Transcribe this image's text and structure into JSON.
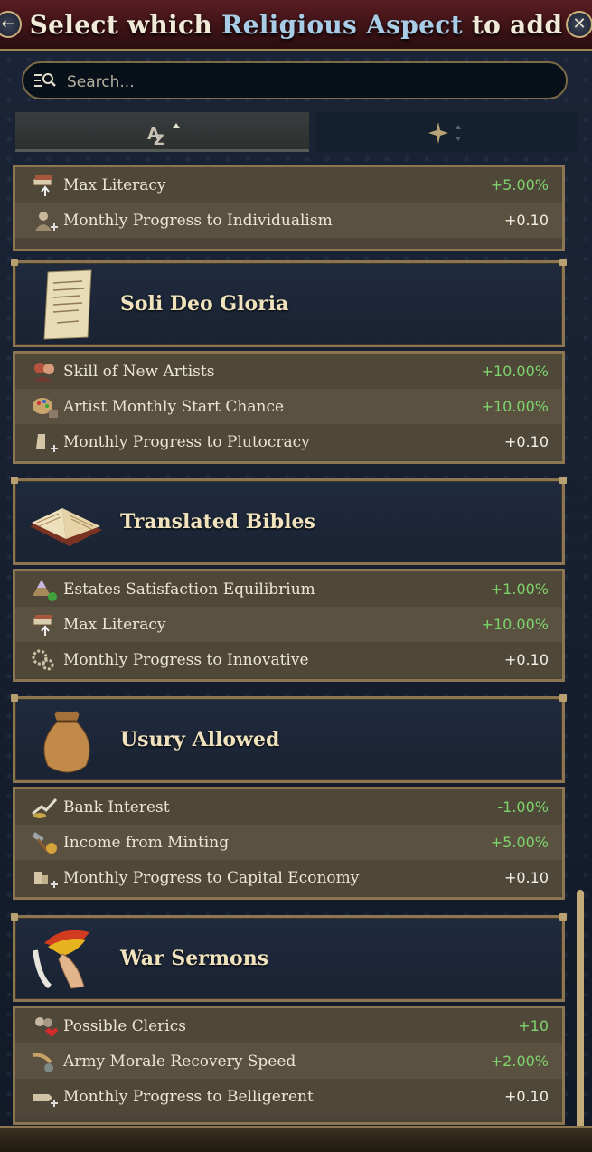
{
  "header": {
    "title_pre": "Select which ",
    "title_highlight": "Religious Aspect",
    "title_post": " to add",
    "back_icon": "back-arrow-icon",
    "close_icon": "close-x-icon"
  },
  "search": {
    "placeholder": "Search...",
    "value": ""
  },
  "sort_tabs": [
    {
      "icon": "alphabetical-sort-icon",
      "state": "ascending",
      "active": true
    },
    {
      "icon": "importance-sort-icon",
      "state": "unsorted",
      "active": false
    }
  ],
  "colors": {
    "positive": "#7ed46c",
    "neutral": "#f2efe6",
    "highlight": "#a9cde6",
    "gold_border": "#8b7651"
  },
  "partial_card": {
    "rows": [
      {
        "icon": "max-literacy-icon",
        "label": "Max Literacy",
        "value": "+5.00%",
        "tone": "pos"
      },
      {
        "icon": "individualism-icon",
        "label": "Monthly Progress to Individualism",
        "value": "+0.10",
        "tone": "neutral"
      }
    ]
  },
  "aspects": [
    {
      "name": "Soli Deo Gloria",
      "image": "parchment-letter-icon",
      "rows": [
        {
          "icon": "artists-icon",
          "label": "Skill of New Artists",
          "value": "+10.00%",
          "tone": "pos"
        },
        {
          "icon": "palette-icon",
          "label": "Artist Monthly Start Chance",
          "value": "+10.00%",
          "tone": "pos"
        },
        {
          "icon": "plutocracy-icon",
          "label": "Monthly Progress to Plutocracy",
          "value": "+0.10",
          "tone": "neutral"
        }
      ]
    },
    {
      "name": "Translated Bibles",
      "image": "open-book-icon",
      "rows": [
        {
          "icon": "estates-pyramid-icon",
          "label": "Estates Satisfaction Equilibrium",
          "value": "+1.00%",
          "tone": "pos"
        },
        {
          "icon": "max-literacy-icon",
          "label": "Max Literacy",
          "value": "+10.00%",
          "tone": "pos"
        },
        {
          "icon": "innovative-gears-icon",
          "label": "Monthly Progress to Innovative",
          "value": "+0.10",
          "tone": "neutral"
        }
      ]
    },
    {
      "name": "Usury Allowed",
      "image": "money-bag-icon",
      "rows": [
        {
          "icon": "bank-interest-icon",
          "label": "Bank Interest",
          "value": "-1.00%",
          "tone": "pos"
        },
        {
          "icon": "minting-hammer-icon",
          "label": "Income from Minting",
          "value": "+5.00%",
          "tone": "pos"
        },
        {
          "icon": "capital-economy-icon",
          "label": "Monthly Progress to Capital Economy",
          "value": "+0.10",
          "tone": "neutral"
        }
      ]
    },
    {
      "name": "War Sermons",
      "image": "praying-hands-flag-icon",
      "rows": [
        {
          "icon": "clerics-icon",
          "label": "Possible Clerics",
          "value": "+10",
          "tone": "pos"
        },
        {
          "icon": "army-morale-icon",
          "label": "Army Morale Recovery Speed",
          "value": "+2.00%",
          "tone": "pos"
        },
        {
          "icon": "belligerent-icon",
          "label": "Monthly Progress to Belligerent",
          "value": "+0.10",
          "tone": "neutral"
        }
      ]
    }
  ]
}
